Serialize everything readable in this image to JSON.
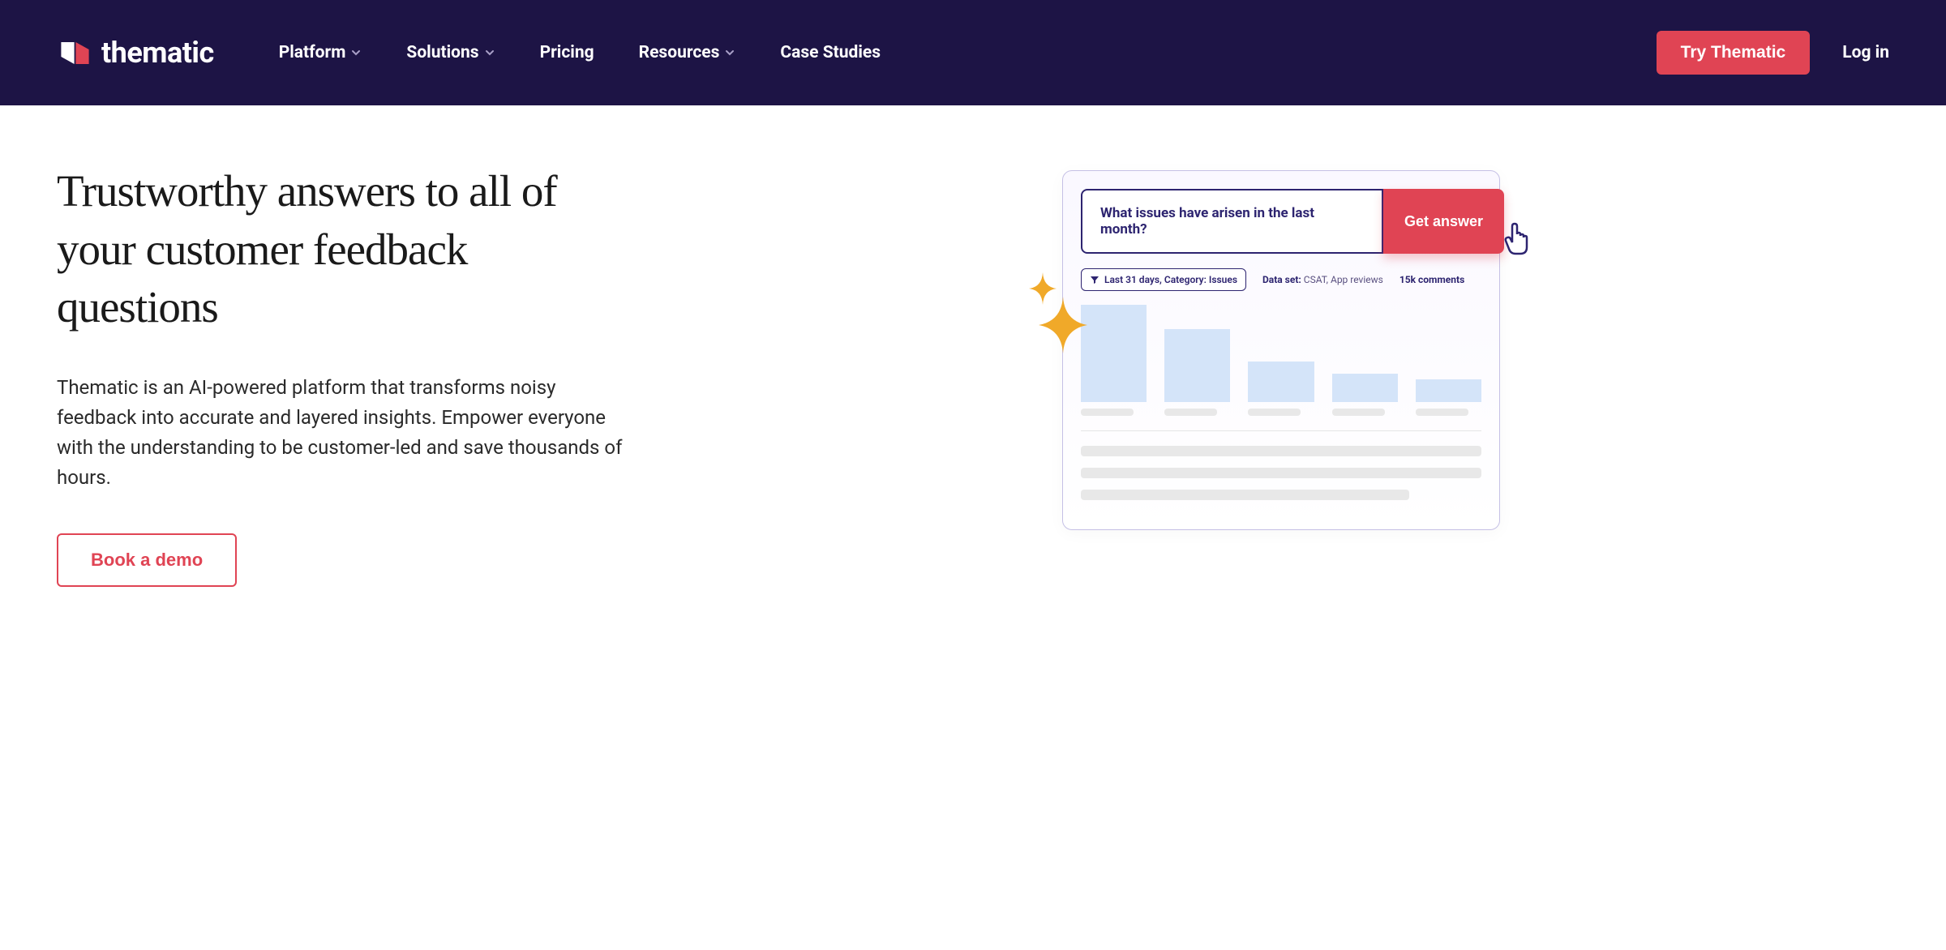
{
  "header": {
    "logo_text": "thematic",
    "nav": [
      {
        "label": "Platform",
        "has_dropdown": true
      },
      {
        "label": "Solutions",
        "has_dropdown": true
      },
      {
        "label": "Pricing",
        "has_dropdown": false
      },
      {
        "label": "Resources",
        "has_dropdown": true
      },
      {
        "label": "Case Studies",
        "has_dropdown": false
      }
    ],
    "try_button": "Try Thematic",
    "login_link": "Log in"
  },
  "hero": {
    "title": "Trustworthy answers to all of your customer feedback questions",
    "description": "Thematic is an AI-powered platform that transforms noisy feedback into accurate and layered insights. Empower everyone with the understanding to be customer-led and save thousands of hours.",
    "book_demo": "Book a demo"
  },
  "demo": {
    "question": "What issues have arisen in the last month?",
    "answer_button": "Get answer",
    "filter_text": "Last 31 days, Category: Issues",
    "data_set_label": "Data set:",
    "data_set_value": "CSAT, App reviews",
    "comments": "15k comments"
  },
  "chart_data": {
    "type": "bar",
    "values": [
      120,
      90,
      50,
      35,
      28
    ],
    "note": "unlabeled descending bar chart illustration"
  },
  "colors": {
    "header_bg": "#1d1445",
    "accent_red": "#e04454",
    "accent_purple": "#2d2470",
    "bar_fill": "#d4e4f9",
    "sparkle": "#f0a929"
  }
}
